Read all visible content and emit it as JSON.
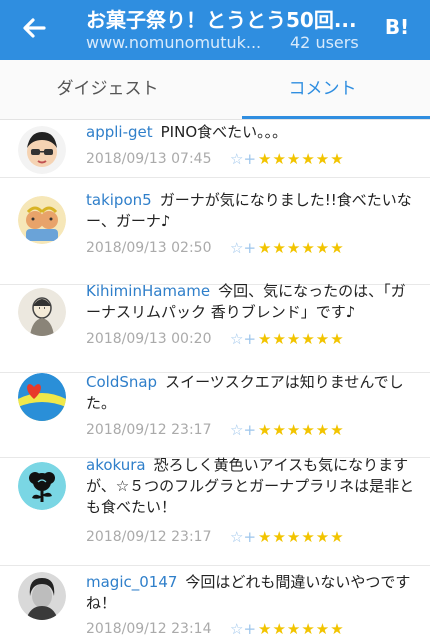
{
  "header": {
    "title": "お菓子祭り！とうとう50回...",
    "url": "www.nomunomutuk...",
    "users": "42 users",
    "hatena_logo": "B!",
    "back_icon": "arrow-left-icon"
  },
  "tabs": [
    {
      "label": "ダイジェスト",
      "active": false
    },
    {
      "label": "コメント",
      "active": true
    }
  ],
  "comments": [
    {
      "user": "appli-get",
      "text": "PINO食べたい。。。",
      "date": "2018/09/13 07:45",
      "stars": "★★★★★★"
    },
    {
      "user": "takipon5",
      "text": "ガーナが気になりました!!食べたいなー、ガーナ♪",
      "date": "2018/09/13 02:50",
      "stars": "★★★★★★"
    },
    {
      "user": "KihiminHamame",
      "text": "今回、気になったのは、「ガーナスリムパック 香りブレンド」です♪",
      "date": "2018/09/13 00:20",
      "stars": "★★★★★★"
    },
    {
      "user": "ColdSnap",
      "text": "スイーツスクエアは知りませんでした。",
      "date": "2018/09/12 23:17",
      "stars": "★★★★★★"
    },
    {
      "user": "akokura",
      "text": "恐ろしく黄色いアイスも気になりますが、☆５つのフルグラとガーナプラリネは是非とも食べたい！",
      "date": "2018/09/12 23:17",
      "stars": "★★★★★★"
    },
    {
      "user": "magic_0147",
      "text": "今回はどれも間違いないやつですね！",
      "date": "2018/09/12 23:14",
      "stars": "★★★★★★"
    }
  ],
  "colors": {
    "accent": "#2f8ee0",
    "star": "#f2c400"
  }
}
